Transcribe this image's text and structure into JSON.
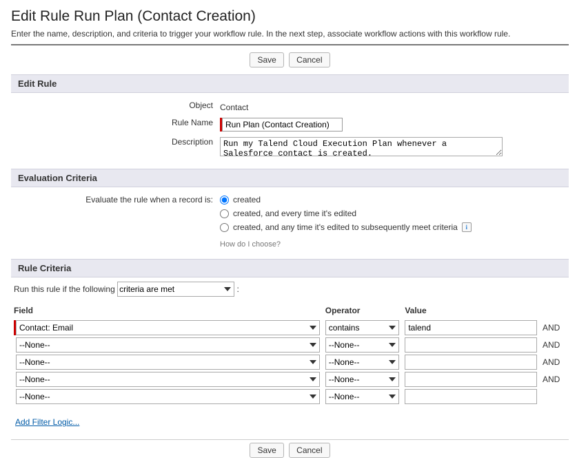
{
  "page_title": "Edit Rule Run Plan (Contact Creation)",
  "subtitle": "Enter the name, description, and criteria to trigger your workflow rule. In the next step, associate workflow actions with this workflow rule.",
  "buttons": {
    "save": "Save",
    "cancel": "Cancel"
  },
  "edit_rule": {
    "header": "Edit Rule",
    "labels": {
      "object": "Object",
      "rule_name": "Rule Name",
      "description": "Description"
    },
    "object_value": "Contact",
    "rule_name_value": "Run Plan (Contact Creation)",
    "description_value": "Run my Talend Cloud Execution Plan whenever a Salesforce contact is created."
  },
  "evaluation": {
    "header": "Evaluation Criteria",
    "label": "Evaluate the rule when a record is:",
    "options": {
      "created": "created",
      "edited": "created, and every time it's edited",
      "meets": "created, and any time it's edited to subsequently meet criteria"
    },
    "selected": "created",
    "help": "How do I choose?"
  },
  "criteria": {
    "header": "Rule Criteria",
    "run_label": "Run this rule if the following",
    "run_select_value": "criteria are met",
    "columns": {
      "field": "Field",
      "operator": "Operator",
      "value": "Value"
    },
    "and": "AND",
    "rows": [
      {
        "field": "Contact: Email",
        "operator": "contains",
        "value": "talend",
        "required": true,
        "show_and": true
      },
      {
        "field": "--None--",
        "operator": "--None--",
        "value": "",
        "required": false,
        "show_and": true
      },
      {
        "field": "--None--",
        "operator": "--None--",
        "value": "",
        "required": false,
        "show_and": true
      },
      {
        "field": "--None--",
        "operator": "--None--",
        "value": "",
        "required": false,
        "show_and": true
      },
      {
        "field": "--None--",
        "operator": "--None--",
        "value": "",
        "required": false,
        "show_and": false
      }
    ],
    "add_filter_link": "Add Filter Logic..."
  }
}
